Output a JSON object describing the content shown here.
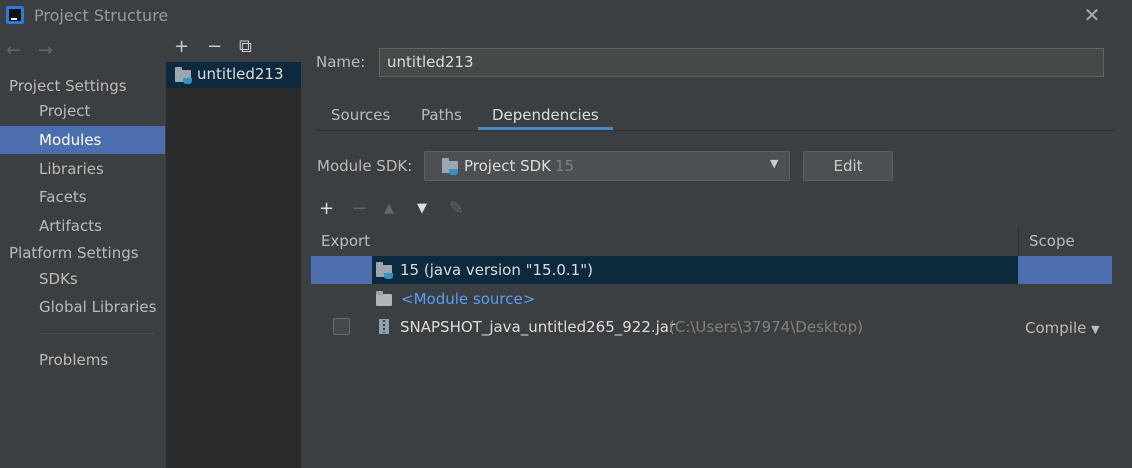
{
  "window": {
    "title": "Project Structure",
    "close_icon": "close-icon"
  },
  "nav": {
    "back_icon": "←",
    "forward_icon": "→",
    "project_settings_header": "Project Settings",
    "project_settings_items": [
      "Project",
      "Modules",
      "Libraries",
      "Facets",
      "Artifacts"
    ],
    "platform_settings_header": "Platform Settings",
    "platform_settings_items": [
      "SDKs",
      "Global Libraries"
    ],
    "problems": "Problems",
    "selected": "Modules"
  },
  "modules": {
    "toolbar": {
      "add": "+",
      "remove": "−",
      "copy": "⧉"
    },
    "items": [
      "untitled213"
    ]
  },
  "details": {
    "name_label": "Name:",
    "name_value": "untitled213",
    "tabs": [
      "Sources",
      "Paths",
      "Dependencies"
    ],
    "active_tab": "Dependencies",
    "module_sdk_label": "Module SDK:",
    "module_sdk_value": "Project SDK",
    "module_sdk_version": "15",
    "edit_button": "Edit",
    "dep_toolbar": {
      "add": "+",
      "remove": "−",
      "up": "▲",
      "down": "▼",
      "edit": "✎"
    },
    "table": {
      "headers": {
        "export": "Export",
        "scope": "Scope"
      },
      "rows": [
        {
          "text": "15 (java version \"15.0.1\")",
          "scope": ""
        },
        {
          "text": "<Module source>",
          "scope": ""
        },
        {
          "text": "SNAPSHOT_java_untitled265_922.jar",
          "path": "(C:\\Users\\37974\\Desktop)",
          "scope": "Compile"
        }
      ]
    }
  },
  "colors": {
    "selection": "#4b6eaf",
    "row_highlight": "#0d293e",
    "link": "#589df6",
    "background": "#3c3f41"
  }
}
